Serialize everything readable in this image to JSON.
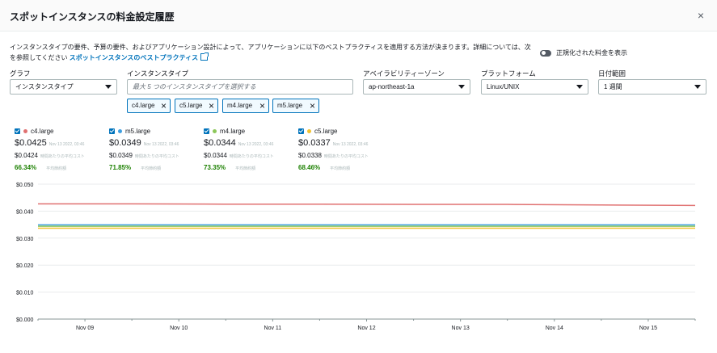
{
  "dialog": {
    "title": "スポットインスタンスの料金設定履歴",
    "close_symbol": "×",
    "description_text": "インスタンスタイプの要件、予算の要件、およびアプリケーション設計によって、アプリケーションに以下のベストプラクティスを適用する方法が決まります。詳細については、次を参照してください ",
    "description_link": "スポットインスタンスのベストプラクティス",
    "normalized_toggle_label": "正規化された料金を表示"
  },
  "filters": {
    "graph": {
      "label": "グラフ",
      "value": "インスタンスタイプ"
    },
    "instance_type": {
      "label": "インスタンスタイプ",
      "placeholder": "最大 5 つのインスタンスタイプを選択する",
      "tokens": [
        "c4.large",
        "c5.large",
        "m4.large",
        "m5.large"
      ]
    },
    "availability_zone": {
      "label": "アベイラビリティーゾーン",
      "value": "ap-northeast-1a"
    },
    "platform": {
      "label": "プラットフォーム",
      "value": "Linux/UNIX"
    },
    "date_range": {
      "label": "日付範囲",
      "value": "1 週間"
    }
  },
  "legend": [
    {
      "name": "c4.large",
      "color": "#e07070",
      "price": "$0.0425",
      "date": "Nov 13 2022, 03:46",
      "avg": "$0.0424",
      "avg_label": "時間あたりの平均コスト",
      "savings": "66.34%",
      "savings_label": "平均節約額"
    },
    {
      "name": "m5.large",
      "color": "#3f9fe0",
      "price": "$0.0349",
      "date": "Nov 13 2022, 03:46",
      "avg": "$0.0349",
      "avg_label": "時間あたりの平均コスト",
      "savings": "71.85%",
      "savings_label": "平均節約額"
    },
    {
      "name": "m4.large",
      "color": "#8cc75a",
      "price": "$0.0344",
      "date": "Nov 13 2022, 03:46",
      "avg": "$0.0344",
      "avg_label": "時間あたりの平均コスト",
      "savings": "73.35%",
      "savings_label": "平均節約額"
    },
    {
      "name": "c5.large",
      "color": "#f2c230",
      "price": "$0.0337",
      "date": "Nov 13 2022, 03:46",
      "avg": "$0.0338",
      "avg_label": "時間あたりの平均コスト",
      "savings": "68.46%",
      "savings_label": "平均節約額"
    }
  ],
  "chart_data": {
    "type": "line",
    "title": "",
    "xlabel": "",
    "ylabel": "",
    "ylim": [
      0,
      0.05
    ],
    "y_ticks": [
      "$0.000",
      "$0.010",
      "$0.020",
      "$0.030",
      "$0.040",
      "$0.050"
    ],
    "x_ticks": [
      "Nov 09",
      "Nov 10",
      "Nov 11",
      "Nov 12",
      "Nov 13",
      "Nov 14",
      "Nov 15"
    ],
    "grid": true,
    "x": [
      "Nov 08",
      "Nov 09",
      "Nov 10",
      "Nov 11",
      "Nov 12",
      "Nov 13",
      "Nov 14",
      "Nov 15"
    ],
    "series": [
      {
        "name": "c4.large",
        "color": "#e07070",
        "values": [
          0.0427,
          0.0427,
          0.0426,
          0.0426,
          0.0425,
          0.0425,
          0.0423,
          0.0421
        ]
      },
      {
        "name": "m5.large",
        "color": "#3f9fe0",
        "values": [
          0.0349,
          0.0349,
          0.0349,
          0.0349,
          0.0349,
          0.0349,
          0.0349,
          0.0349
        ]
      },
      {
        "name": "m4.large",
        "color": "#8cc75a",
        "values": [
          0.0344,
          0.0344,
          0.0344,
          0.0344,
          0.0344,
          0.0344,
          0.0344,
          0.0344
        ]
      },
      {
        "name": "c5.large",
        "color": "#f2c230",
        "values": [
          0.0337,
          0.0337,
          0.0337,
          0.0337,
          0.0337,
          0.0337,
          0.0337,
          0.0337
        ]
      }
    ]
  }
}
